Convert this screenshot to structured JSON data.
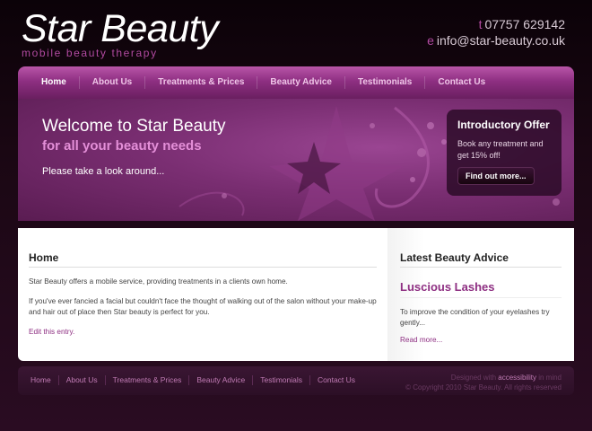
{
  "header": {
    "logo_title": "Star Beauty",
    "logo_tagline": "mobile beauty therapy",
    "phone_prefix": "t",
    "phone": "07757 629142",
    "email_prefix": "e",
    "email": "info@star-beauty.co.uk"
  },
  "nav": {
    "items": [
      {
        "label": "Home"
      },
      {
        "label": "About Us"
      },
      {
        "label": "Treatments & Prices"
      },
      {
        "label": "Beauty Advice"
      },
      {
        "label": "Testimonials"
      },
      {
        "label": "Contact Us"
      }
    ]
  },
  "banner": {
    "title": "Welcome to Star Beauty",
    "subtitle": "for all your beauty needs",
    "text": "Please take a look around..."
  },
  "offer": {
    "title": "Introductory Offer",
    "text": "Book any treatment and get 15% off!",
    "button": "Find out more..."
  },
  "main": {
    "title": "Home",
    "para1": "Star Beauty offers a mobile service, providing treatments in a clients own home.",
    "para2": "If you've ever fancied a facial but couldn't face the thought of walking out of the salon without your make-up and hair out of place then Star beauty is perfect for you.",
    "edit_link": "Edit this entry."
  },
  "sidebar": {
    "title": "Latest Beauty Advice",
    "post_title": "Luscious Lashes",
    "post_excerpt": "To improve the condition of your eyelashes try gently...",
    "read_more": "Read more..."
  },
  "footer": {
    "nav": [
      {
        "label": "Home"
      },
      {
        "label": "About Us"
      },
      {
        "label": "Treatments & Prices"
      },
      {
        "label": "Beauty Advice"
      },
      {
        "label": "Testimonials"
      },
      {
        "label": "Contact Us"
      }
    ],
    "designed_prefix": "Designed with",
    "designed_link": "accessibility",
    "designed_suffix": "in mind",
    "copyright": "© Copyright 2010 Star Beauty. All rights reserved"
  },
  "colors": {
    "accent": "#8e2f82",
    "accent_light": "#e48fd8",
    "background": "#1a0713"
  }
}
